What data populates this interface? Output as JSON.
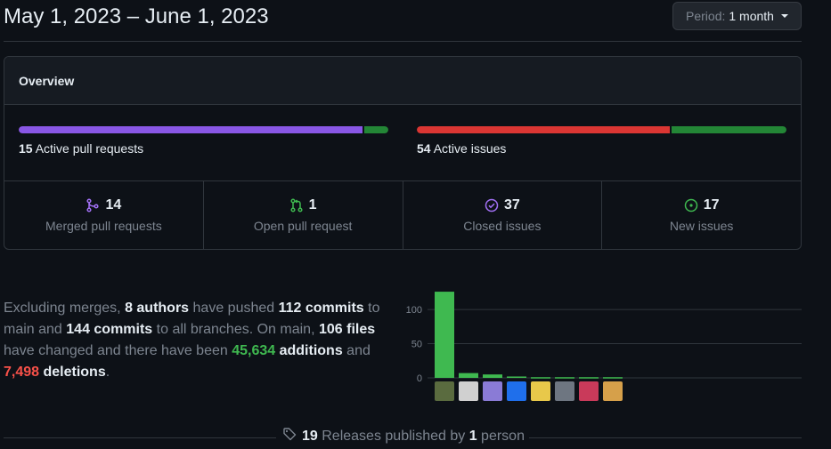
{
  "header": {
    "date_range": "May 1, 2023 – June 1, 2023",
    "period_label": "Period:",
    "period_value": "1 month"
  },
  "overview": {
    "title": "Overview",
    "pull_requests": {
      "count": "15",
      "label": "Active pull requests",
      "merged_fraction": 0.93,
      "colors": [
        "#8957e5",
        "#238636"
      ]
    },
    "issues": {
      "count": "54",
      "label": "Active issues",
      "closed_fraction": 0.685,
      "colors": [
        "#da3633",
        "#238636"
      ]
    },
    "stats": [
      {
        "icon": "merged-pr-icon",
        "count": "14",
        "label": "Merged pull requests",
        "color": "#a371f7"
      },
      {
        "icon": "open-pr-icon",
        "count": "1",
        "label": "Open pull request",
        "color": "#3fb950"
      },
      {
        "icon": "closed-issue-icon",
        "count": "37",
        "label": "Closed issues",
        "color": "#a371f7"
      },
      {
        "icon": "new-issue-icon",
        "count": "17",
        "label": "New issues",
        "color": "#3fb950"
      }
    ]
  },
  "summary": {
    "t1": "Excluding merges, ",
    "authors": "8 authors",
    "t2": " have pushed ",
    "commits_main": "112 commits",
    "t3": " to main and ",
    "commits_all": "144 commits",
    "t4": " to all branches. On main, ",
    "files": "106 files",
    "t5": " have changed and there have been ",
    "additions_num": "45,634",
    "additions_word": " additions",
    "t6": " and ",
    "deletions_num": "7,498",
    "deletions_word": " deletions",
    "t7": "."
  },
  "chart_data": {
    "type": "bar",
    "categories": [
      "author-1",
      "author-2",
      "author-3",
      "author-4",
      "author-5",
      "author-6",
      "author-7",
      "author-8"
    ],
    "values": [
      126,
      7,
      5,
      2,
      1,
      1,
      1,
      1
    ],
    "ylim": [
      0,
      130
    ],
    "yticks": [
      "0",
      "50",
      "100"
    ],
    "grid": true,
    "bar_color": "#3fb950",
    "avatar_colors": [
      "#5a6b3f",
      "#d0d0d0",
      "#8a7bd6",
      "#1f6feb",
      "#e8c84a",
      "#6e7681",
      "#c93a5a",
      "#d6a04a"
    ]
  },
  "releases": {
    "count": "19",
    "t1": " Releases published by ",
    "people": "1",
    "t2": " person"
  }
}
